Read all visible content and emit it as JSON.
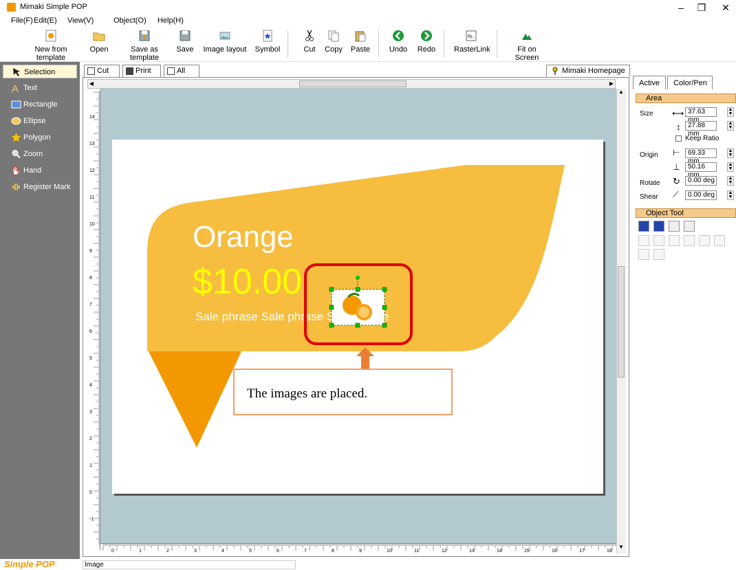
{
  "window": {
    "title": "Mimaki Simple POP",
    "minimize": "–",
    "restore": "❐",
    "close": "✕"
  },
  "menu": [
    "File(F)",
    "Edit(E)",
    "View(V)",
    "Object(O)",
    "Help(H)"
  ],
  "toolbar": {
    "new_from_template": "New from template",
    "open": "Open",
    "save_as_template": "Save as template",
    "save": "Save",
    "image_layout": "Image layout",
    "symbol": "Symbol",
    "cut": "Cut",
    "copy": "Copy",
    "paste": "Paste",
    "undo": "Undo",
    "redo": "Redo",
    "rasterlink": "RasterLink",
    "fit_on_screen": "Fit on Screen"
  },
  "tools": [
    "Selection",
    "Text",
    "Rectangle",
    "Ellipse",
    "Polygon",
    "Zoom",
    "Hand",
    "Register Mark"
  ],
  "tabs": {
    "cut": "Cut",
    "print": "Print",
    "all": "All",
    "homepage": "Mimaki Homepage"
  },
  "canvas": {
    "title_text": "Orange",
    "price_text": "$10.00",
    "sale_text": "Sale  phrase Sale phrase Sale  phrase",
    "callout": "The images are placed.",
    "vruler_labels": [
      "14",
      "13",
      "12",
      "11",
      "10",
      "9",
      "8",
      "7",
      "6",
      "5",
      "4",
      "3",
      "2",
      "1",
      "0",
      "-1"
    ],
    "hruler_labels": [
      "0",
      "1",
      "2",
      "3",
      "4",
      "5",
      "6",
      "7",
      "8",
      "9",
      "10",
      "11",
      "12",
      "13",
      "14",
      "15",
      "16",
      "17",
      "18"
    ]
  },
  "right_panel": {
    "tab_active": "Active",
    "tab_color": "Color/Pen",
    "area_header": "Area",
    "size_label": "Size",
    "width": "37.63 mm",
    "height": "27.88 mm",
    "keep_ratio": "Keep Ratio",
    "origin_label": "Origin",
    "origin_x": "69.33 mm",
    "origin_y": "50.16 mm",
    "rotate_label": "Rotate",
    "rotate": "0.00 deg",
    "shear_label": "Shear",
    "shear": "0.00 deg",
    "object_tool_header": "Object Tool"
  },
  "status": {
    "logo": "Simple POP",
    "text": "Image"
  },
  "colors": {
    "accent_orange": "#f39800",
    "banner_yellow": "#f6bd3f",
    "price_yellow": "#ffff00",
    "callout_border": "#ed7d31",
    "highlight_red": "#e00000"
  }
}
